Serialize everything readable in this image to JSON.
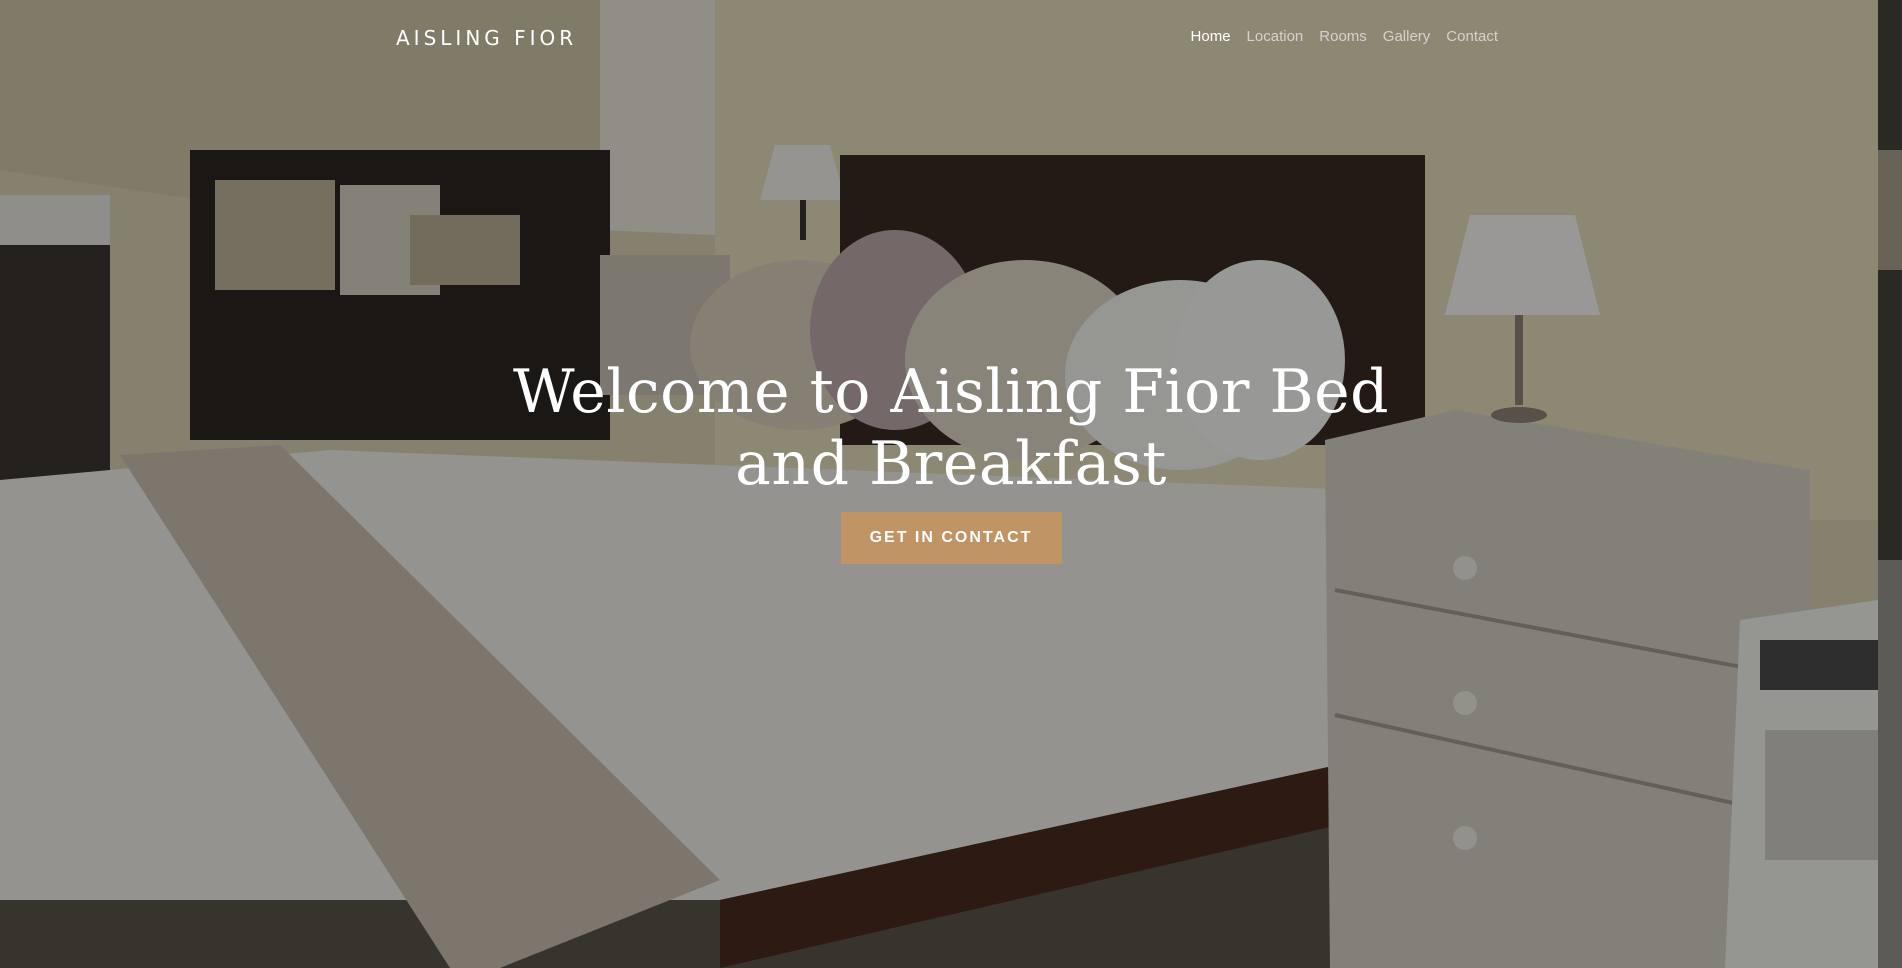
{
  "navbar": {
    "brand": "AISLING FIOR",
    "links": [
      {
        "label": "Home",
        "active": true
      },
      {
        "label": "Location",
        "active": false
      },
      {
        "label": "Rooms",
        "active": false
      },
      {
        "label": "Gallery",
        "active": false
      },
      {
        "label": "Contact",
        "active": false
      }
    ]
  },
  "hero": {
    "title": "Welcome to Aisling Fior Bed and Breakfast",
    "cta_label": "GET IN CONTACT",
    "background_image": "bedroom-photo"
  },
  "colors": {
    "accent": "#c09464",
    "text": "#ffffff",
    "nav_inactive": "rgba(255,255,255,0.62)"
  }
}
